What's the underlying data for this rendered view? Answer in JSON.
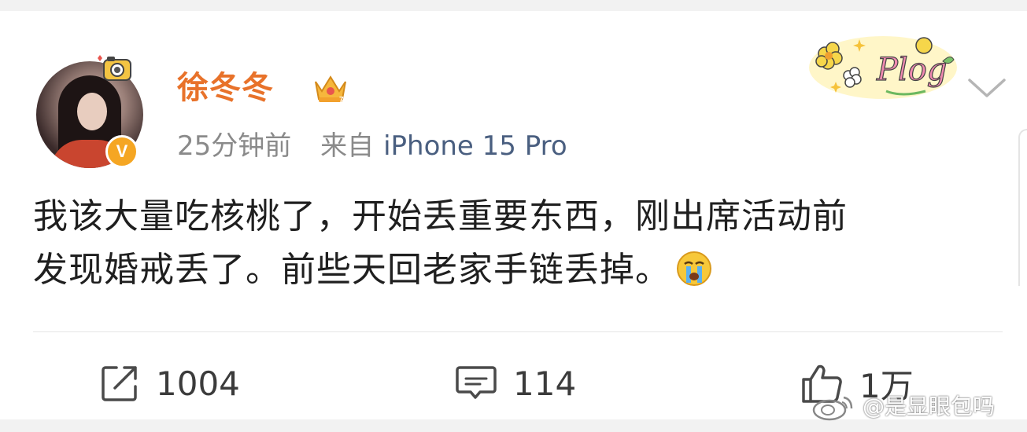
{
  "post": {
    "author": {
      "name": "徐冬冬",
      "verified_badge": "V"
    },
    "meta": {
      "time": "25分钟前",
      "source_prefix": "来自",
      "source_device": "iPhone 15 Pro"
    },
    "sticker_text": "Plog",
    "text_line1": "我该大量吃核桃了，开始丢重要东西，刚出席活动前",
    "text_line2": "发现婚戒丢了。前些天回老家手链丢掉。",
    "emoji": "crying-face"
  },
  "actions": {
    "repost_count": "1004",
    "comment_count": "114",
    "like_count": "1万"
  },
  "watermark": {
    "text": "@是显眼包吗"
  },
  "colors": {
    "username": "#e8722a",
    "source_device": "#4a5f80",
    "badge": "#f5a623"
  }
}
